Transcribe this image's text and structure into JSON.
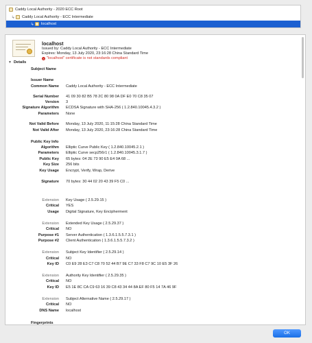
{
  "tree": {
    "items": [
      {
        "label": "Caddy Local Authority - 2020 ECC Root",
        "selected": false
      },
      {
        "label": "Caddy Local Authority - ECC Intermediate",
        "selected": false
      },
      {
        "label": "localhost",
        "selected": true
      }
    ]
  },
  "summary": {
    "common_name": "localhost",
    "issuer": "Issued by: Caddy Local Authority - ECC Intermediate",
    "expires": "Expires: Monday, 13 July 2020, 23:16:28 China Standard Time",
    "warning": "\"localhost\" certificate is not standards compliant"
  },
  "details": {
    "header": "Details",
    "rows": [
      {
        "k": "Subject Name",
        "v": "",
        "type": "section"
      },
      {
        "k": "Issuer Name",
        "v": "",
        "type": "section"
      },
      {
        "k": "Common Name",
        "v": "Caddy Local Authority - ECC Intermediate"
      },
      {
        "k": "Serial Number",
        "v": "41 09 30 82 B5 78 2C 80 98 0A DF E0 70 C8 35 07"
      },
      {
        "k": "Version",
        "v": "3"
      },
      {
        "k": "Signature Algorithm",
        "v": "ECDSA Signature with SHA-256 ( 1.2.840.10045.4.3.2 )"
      },
      {
        "k": "Parameters",
        "v": "None"
      },
      {
        "k": "Not Valid Before",
        "v": "Monday, 13 July 2020, 11:15:28 China Standard Time"
      },
      {
        "k": "Not Valid After",
        "v": "Monday, 13 July 2020, 23:16:28 China Standard Time"
      },
      {
        "k": "Public Key Info",
        "v": "",
        "type": "section"
      },
      {
        "k": "Algorithm",
        "v": "Elliptic Curve Public Key ( 1.2.840.10045.2.1 )"
      },
      {
        "k": "Parameters",
        "v": "Elliptic Curve secp256r1 ( 1.2.840.10045.3.1.7 )"
      },
      {
        "k": "Public Key",
        "v": "65 bytes: 04 2E 73 90 E5 E4 0A 68 ..."
      },
      {
        "k": "Key Size",
        "v": "256 bits"
      },
      {
        "k": "Key Usage",
        "v": "Encrypt, Verify, Wrap, Derive"
      },
      {
        "k": "Signature",
        "v": "70 bytes: 30 44 02 20 43 39 F5 C0 ..."
      },
      {
        "k": "Extension",
        "v": "Key Usage ( 2.5.29.15 )",
        "type": "grey"
      },
      {
        "k": "Critical",
        "v": "YES"
      },
      {
        "k": "Usage",
        "v": "Digital Signature, Key Encipherment"
      },
      {
        "k": "Extension",
        "v": "Extended Key Usage ( 2.5.29.37 )",
        "type": "grey"
      },
      {
        "k": "Critical",
        "v": "NO"
      },
      {
        "k": "Purpose #1",
        "v": "Server Authentication ( 1.3.6.1.5.5.7.3.1 )"
      },
      {
        "k": "Purpose #2",
        "v": "Client Authentication ( 1.3.6.1.5.5.7.3.2 )"
      },
      {
        "k": "Extension",
        "v": "Subject Key Identifier ( 2.5.29.14 )",
        "type": "grey"
      },
      {
        "k": "Critical",
        "v": "NO"
      },
      {
        "k": "Key ID",
        "v": "C0 E9 28 E3 C7 C8 70 52 44 B7 9E C7 33 F8 C7 9C 10 E5 3F 26"
      },
      {
        "k": "Extension",
        "v": "Authority Key Identifier ( 2.5.29.35 )",
        "type": "grey"
      },
      {
        "k": "Critical",
        "v": "NO"
      },
      {
        "k": "Key ID",
        "v": "E5 1E 8C CA C9 63 16 39 C8 43 34 44 8A EF 80 F5 14 7A 46 9F"
      },
      {
        "k": "Extension",
        "v": "Subject Alternative Name ( 2.5.29.17 )",
        "type": "grey"
      },
      {
        "k": "Critical",
        "v": "NO"
      },
      {
        "k": "DNS Name",
        "v": "localhost"
      },
      {
        "k": "Fingerprints",
        "v": "",
        "type": "section"
      }
    ]
  },
  "ok_label": "OK",
  "colors": {
    "selection": "#1b5fd1",
    "warning": "#d12c23",
    "button": "#1a6fe6"
  }
}
